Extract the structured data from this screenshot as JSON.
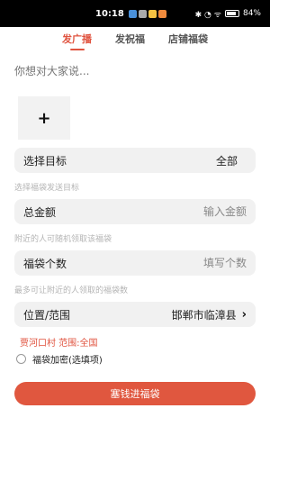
{
  "status_bar": {
    "time": "10:18",
    "battery": "84%",
    "battery_level": 0.84
  },
  "tabs": [
    {
      "label": "发广播",
      "active": true
    },
    {
      "label": "发祝福",
      "active": false
    },
    {
      "label": "店铺福袋",
      "active": false
    }
  ],
  "message": {
    "placeholder": "你想对大家说..."
  },
  "add_image": {
    "symbol": "+"
  },
  "target": {
    "label": "选择目标",
    "value": "全部",
    "hint": "选择福袋发送目标"
  },
  "amount": {
    "label": "总金额",
    "placeholder": "输入金额",
    "hint": "附近的人可随机领取该福袋"
  },
  "count": {
    "label": "福袋个数",
    "placeholder": "填写个数",
    "hint": "最多可让附近的人领取的福袋数"
  },
  "location": {
    "label": "位置/范围",
    "value": "邯郸市临漳县",
    "info": "贾河口村 范围:全国"
  },
  "encrypt": {
    "label": "福袋加密(选填项)"
  },
  "submit": {
    "label": "塞钱进福袋"
  },
  "colors": {
    "accent": "#e0533f",
    "field_bg": "#f1f1f1",
    "hint": "#b5b5b5"
  },
  "icons": {
    "add": "plus-icon",
    "chevron": "chevron-right-icon"
  }
}
